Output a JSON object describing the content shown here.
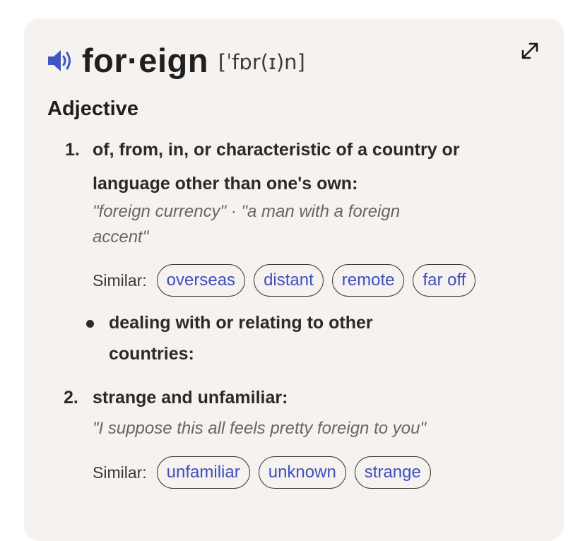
{
  "entry": {
    "headword": "for·eign",
    "pronunciation": "[ˈfɒr(ɪ)n]",
    "part_of_speech": "Adjective"
  },
  "senses": [
    {
      "number": "1.",
      "definition_line1": "of, from, in, or characteristic of a country or",
      "definition_line2": "language other than one's own:",
      "example_line1": "\"foreign currency\" · \"a man with a foreign",
      "example_line2": "accent\"",
      "similar_label": "Similar:",
      "similar": [
        "overseas",
        "distant",
        "remote",
        "far off"
      ],
      "subsense": {
        "line1": "dealing with or relating to other",
        "line2": "countries:"
      }
    },
    {
      "number": "2.",
      "definition": "strange and unfamiliar:",
      "example": "\"I suppose this all feels pretty foreign to you\"",
      "similar_label": "Similar:",
      "similar": [
        "unfamiliar",
        "unknown",
        "strange"
      ]
    }
  ],
  "icons": {
    "audio": "speaker-icon",
    "expand": "expand-icon"
  },
  "colors": {
    "card_background": "#f5f2ef",
    "chip_text": "#3e4fbf",
    "speaker": "#3e55c2"
  }
}
